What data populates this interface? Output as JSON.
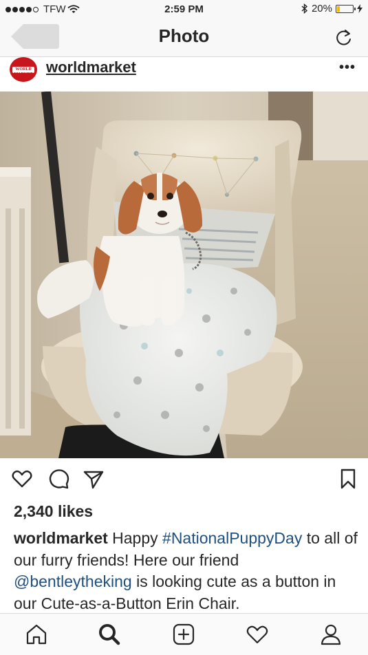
{
  "status_bar": {
    "carrier": "TFW",
    "time": "2:59 PM",
    "battery": "20%",
    "battery_level": 0.2
  },
  "nav": {
    "title": "Photo"
  },
  "post": {
    "username": "worldmarket",
    "avatar_text": "WORLD MARKET",
    "likes": "2,340 likes",
    "caption": {
      "username": "worldmarket",
      "text_before": "Happy",
      "hashtag": "#NationalPuppyDay",
      "text_middle": "to all of our furry friends! Here our friend",
      "mention": "@bentleytheking",
      "text_after": "is looking cute as a button in our Cute-as-a-Button Erin Chair."
    }
  },
  "icons": {
    "like": "heart-icon",
    "comment": "comment-icon",
    "share": "send-icon",
    "save": "bookmark-icon",
    "home": "home-icon",
    "search": "search-icon",
    "add": "add-post-icon",
    "activity": "heart-icon",
    "profile": "profile-icon"
  },
  "colors": {
    "link": "#1e4f7f",
    "brand_red": "#c8161d",
    "battery": "#f5b700"
  }
}
